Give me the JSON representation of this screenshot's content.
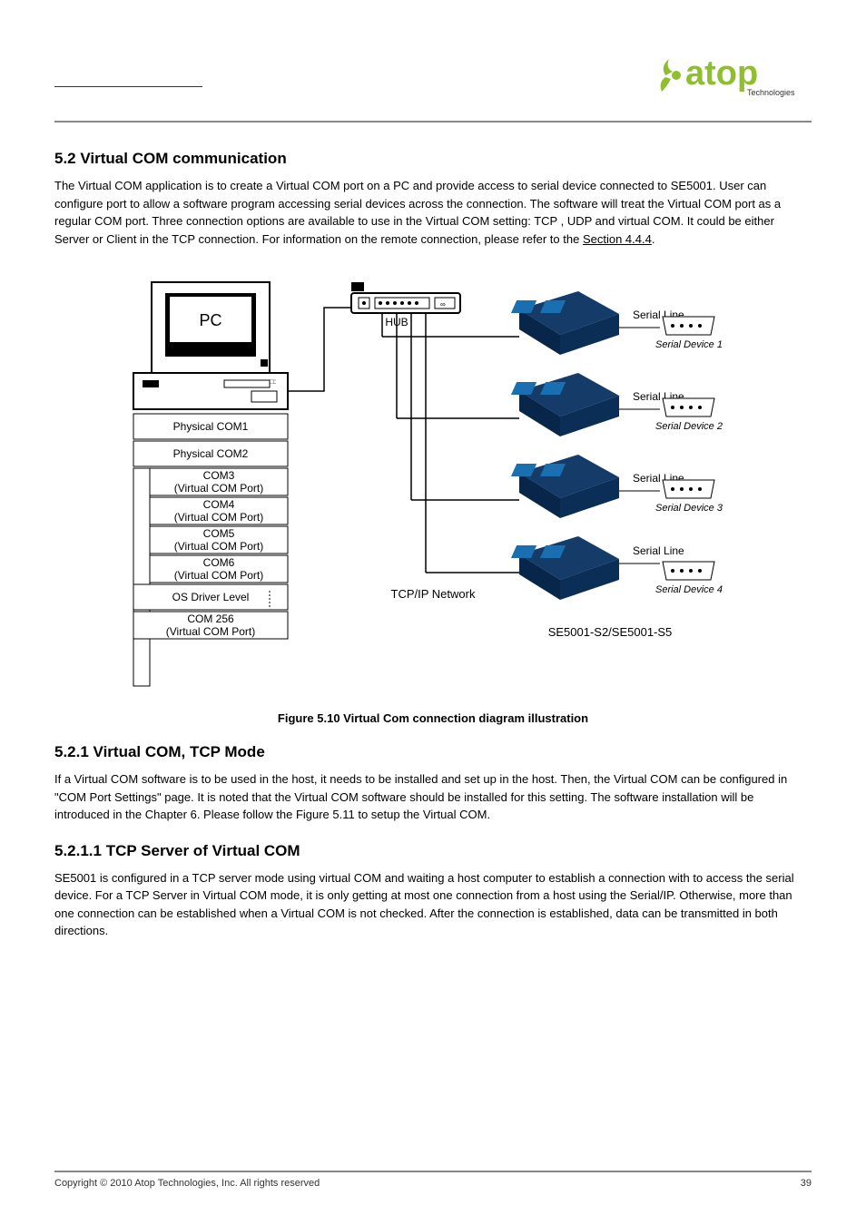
{
  "brand": {
    "name": "atop",
    "tagline": "Technologies"
  },
  "section": {
    "number": "5.2",
    "title": "Virtual COM communication"
  },
  "para1": "The Virtual COM application is to create a Virtual COM port on a PC and provide access to serial device connected to SE5001. User can configure port to allow a software program accessing serial devices across the connection. The software will treat the Virtual COM port as a regular COM port. Three connection options are available to use in the Virtual COM setting: TCP , UDP and virtual COM. It could be either Server or Client in the TCP connection. For information on the remote connection, please refer to the ",
  "para1_link": "Section 4.4.4",
  "para1_tail": ".",
  "figure": {
    "pc_label": "PC",
    "com_phys1": "Physical COM1",
    "com_phys2": "Physical COM2",
    "com3_a": "COM3",
    "com3_b": "(Virtual COM Port)",
    "com4_a": "COM4",
    "com4_b": "(Virtual COM Port)",
    "com5_a": "COM5",
    "com5_b": "(Virtual COM Port)",
    "com6_a": "COM6",
    "com6_b": "(Virtual COM Port)",
    "osdriver": "OS Driver Level",
    "com256_a": "COM 256",
    "com256_b": "(Virtual COM Port)",
    "hub": "HUB",
    "network": "TCP/IP Network",
    "serial_line": "Serial Line",
    "dev1": "Serial Device 1",
    "dev2": "Serial Device 2",
    "dev3": "Serial Device 3",
    "dev4": "Serial Device 4",
    "model": "SE5001-S2/SE5001-S5",
    "caption": "Figure 5.10  Virtual Com connection diagram illustration"
  },
  "subsection1": {
    "number": "5.2.1",
    "title": "Virtual COM, TCP Mode",
    "text": "If a Virtual COM software is to be used in the host, it needs to be installed and set up in the host. Then, the Virtual COM can be configured in \"COM Port Settings\" page. It is noted that the Virtual COM software should be installed for this setting. The software installation will be introduced in the Chapter 6. Please follow the Figure 5.11 to setup the Virtual COM."
  },
  "subsection2": {
    "number": "5.2.1.1",
    "title": "TCP Server of Virtual COM",
    "text": "SE5001 is configured in a TCP server mode using virtual COM and waiting a host computer to establish a connection with to access the serial device. For a TCP Server in Virtual COM mode, it is only getting at most one connection from a host using the Serial/IP. Otherwise, more than one connection can be established when a Virtual COM is not checked. After the connection is established, data can be transmitted in both directions."
  },
  "footer": {
    "left": "Copyright © 2010 Atop Technologies, Inc.  All rights reserved",
    "right": "39"
  }
}
